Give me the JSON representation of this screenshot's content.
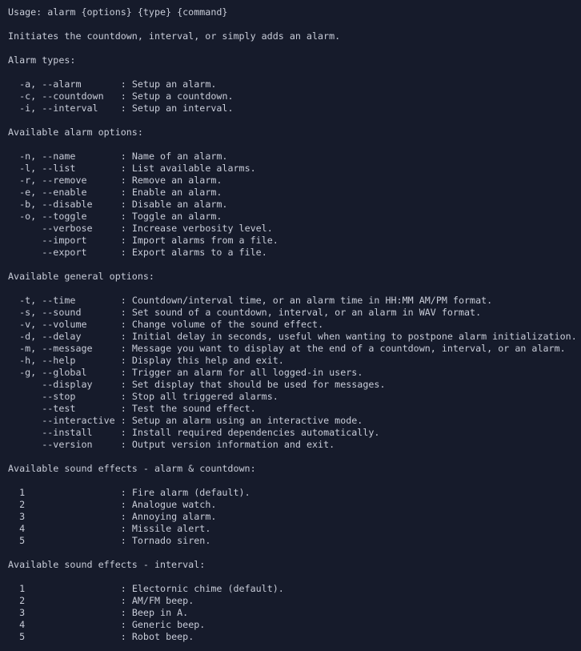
{
  "terminal": {
    "background_color": "#161b2b",
    "text_color": "#c8ccd8",
    "program": "alarm",
    "usage": "Usage: alarm {options} {type} {command}",
    "description": "Initiates the countdown, interval, or simply adds an alarm.",
    "sections": [
      {
        "heading": "Alarm types:",
        "entries": [
          {
            "flags": "-a, --alarm",
            "separator": ":",
            "description": "Setup an alarm."
          },
          {
            "flags": "-c, --countdown",
            "separator": ":",
            "description": "Setup a countdown."
          },
          {
            "flags": "-i, --interval",
            "separator": ":",
            "description": "Setup an interval."
          }
        ]
      },
      {
        "heading": "Available alarm options:",
        "entries": [
          {
            "flags": "-n, --name",
            "separator": ":",
            "description": "Name of an alarm."
          },
          {
            "flags": "-l, --list",
            "separator": ":",
            "description": "List available alarms."
          },
          {
            "flags": "-r, --remove",
            "separator": ":",
            "description": "Remove an alarm."
          },
          {
            "flags": "-e, --enable",
            "separator": ":",
            "description": "Enable an alarm."
          },
          {
            "flags": "-b, --disable",
            "separator": ":",
            "description": "Disable an alarm."
          },
          {
            "flags": "-o, --toggle",
            "separator": ":",
            "description": "Toggle an alarm."
          },
          {
            "flags": "    --verbose",
            "separator": ":",
            "description": "Increase verbosity level."
          },
          {
            "flags": "    --import",
            "separator": ":",
            "description": "Import alarms from a file."
          },
          {
            "flags": "    --export",
            "separator": ":",
            "description": "Export alarms to a file."
          }
        ]
      },
      {
        "heading": "Available general options:",
        "entries": [
          {
            "flags": "-t, --time",
            "separator": ":",
            "description": "Countdown/interval time, or an alarm time in HH:MM AM/PM format."
          },
          {
            "flags": "-s, --sound",
            "separator": ":",
            "description": "Set sound of a countdown, interval, or an alarm in WAV format."
          },
          {
            "flags": "-v, --volume",
            "separator": ":",
            "description": "Change volume of the sound effect."
          },
          {
            "flags": "-d, --delay",
            "separator": ":",
            "description": "Initial delay in seconds, useful when wanting to postpone alarm initialization."
          },
          {
            "flags": "-m, --message",
            "separator": ":",
            "description": "Message you want to display at the end of a countdown, interval, or an alarm."
          },
          {
            "flags": "-h, --help",
            "separator": ":",
            "description": "Display this help and exit."
          },
          {
            "flags": "-g, --global",
            "separator": ":",
            "description": "Trigger an alarm for all logged-in users."
          },
          {
            "flags": "    --display",
            "separator": ":",
            "description": "Set display that should be used for messages."
          },
          {
            "flags": "    --stop",
            "separator": ":",
            "description": "Stop all triggered alarms."
          },
          {
            "flags": "    --test",
            "separator": ":",
            "description": "Test the sound effect."
          },
          {
            "flags": "    --interactive",
            "separator": ":",
            "description": "Setup an alarm using an interactive mode."
          },
          {
            "flags": "    --install",
            "separator": ":",
            "description": "Install required dependencies automatically."
          },
          {
            "flags": "    --version",
            "separator": ":",
            "description": "Output version information and exit."
          }
        ]
      },
      {
        "heading": "Available sound effects - alarm & countdown:",
        "entries": [
          {
            "flags": "1",
            "separator": ":",
            "description": "Fire alarm (default)."
          },
          {
            "flags": "2",
            "separator": ":",
            "description": "Analogue watch."
          },
          {
            "flags": "3",
            "separator": ":",
            "description": "Annoying alarm."
          },
          {
            "flags": "4",
            "separator": ":",
            "description": "Missile alert."
          },
          {
            "flags": "5",
            "separator": ":",
            "description": "Tornado siren."
          }
        ]
      },
      {
        "heading": "Available sound effects - interval:",
        "entries": [
          {
            "flags": "1",
            "separator": ":",
            "description": "Electornic chime (default)."
          },
          {
            "flags": "2",
            "separator": ":",
            "description": "AM/FM beep."
          },
          {
            "flags": "3",
            "separator": ":",
            "description": "Beep in A."
          },
          {
            "flags": "4",
            "separator": ":",
            "description": "Generic beep."
          },
          {
            "flags": "5",
            "separator": ":",
            "description": "Robot beep."
          }
        ]
      }
    ]
  }
}
